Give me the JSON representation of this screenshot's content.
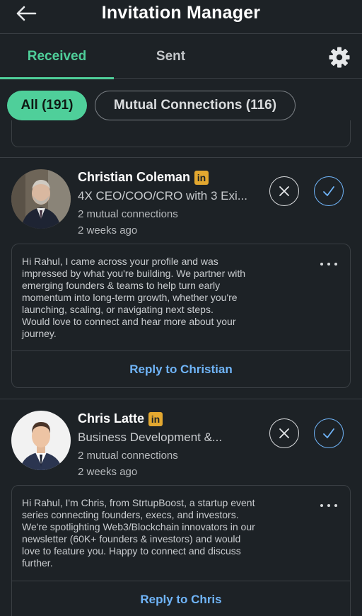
{
  "header": {
    "title": "Invitation Manager",
    "back_icon": "arrow-left-icon"
  },
  "tabs": [
    {
      "label": "Received",
      "active": true
    },
    {
      "label": "Sent",
      "active": false
    }
  ],
  "settings_icon": "gear-icon",
  "filters": [
    {
      "label": "All (191)",
      "selected": true
    },
    {
      "label": "Mutual Connections (116)",
      "selected": false
    }
  ],
  "colors": {
    "accent": "#4fcf9a",
    "link": "#70b5f9",
    "linkedin_badge": "#e3a830",
    "background": "#1d2226"
  },
  "invitations": [
    {
      "name": "Christian Coleman",
      "badge": "in",
      "headline": "4X CEO/COO/CRO with 3 Exi...",
      "mutual": "2 mutual connections",
      "time": "2 weeks ago",
      "message": "Hi Rahul, I came across your profile and was\nimpressed by what you're building. We partner with\nemerging founders & teams to help turn early\nmomentum into long-term growth, whether you're\nlaunching, scaling, or navigating next steps.\nWould love to connect and hear more about your\njourney.",
      "reply_label": "Reply to Christian"
    },
    {
      "name": "Chris Latte",
      "badge": "in",
      "headline": "Business Development &...",
      "mutual": "2 mutual connections",
      "time": "2 weeks ago",
      "message": "Hi Rahul, I'm Chris, from StrtupBoost, a startup event\nseries connecting founders, execs, and investors.\nWe're spotlighting Web3/Blockchain innovators in our\nnewsletter (60K+ founders & investors) and would\nlove to feature you. Happy to connect and discuss\nfurther.",
      "reply_label": "Reply to Chris"
    }
  ]
}
